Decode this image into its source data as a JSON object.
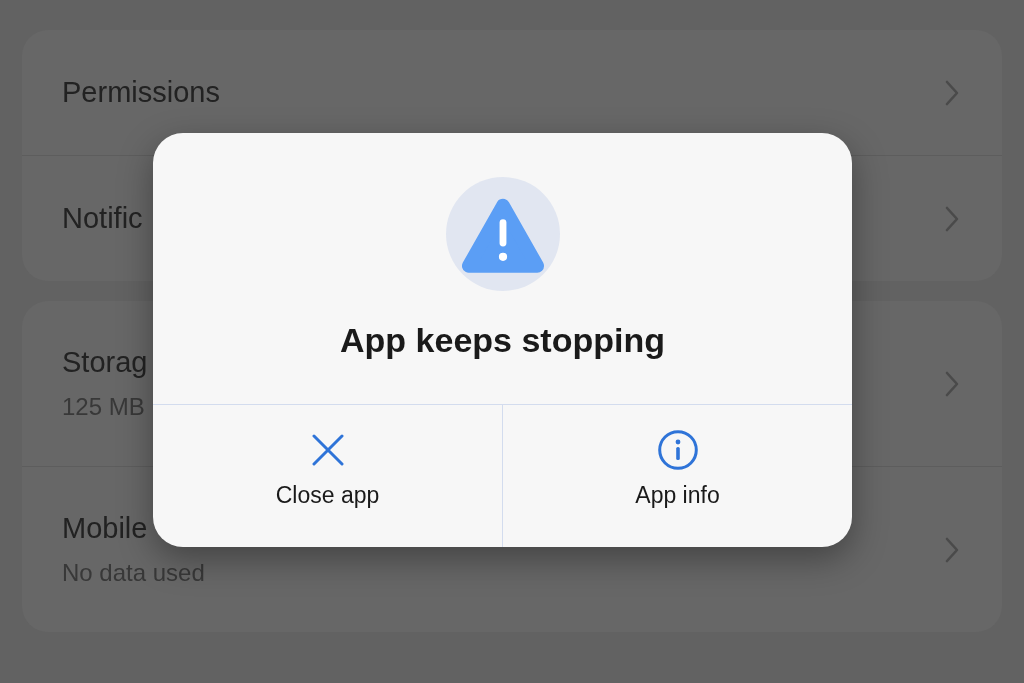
{
  "settings": {
    "groups": [
      {
        "items": [
          {
            "title": "Permissions"
          },
          {
            "title": "Notific"
          }
        ]
      },
      {
        "items": [
          {
            "title": "Storag",
            "subtitle": "125 MB"
          },
          {
            "title": "Mobile",
            "subtitle": "No data used"
          }
        ]
      }
    ]
  },
  "dialog": {
    "title": "App keeps stopping",
    "actions": [
      {
        "kind": "close",
        "label": "Close app"
      },
      {
        "kind": "info",
        "label": "App info"
      }
    ]
  }
}
